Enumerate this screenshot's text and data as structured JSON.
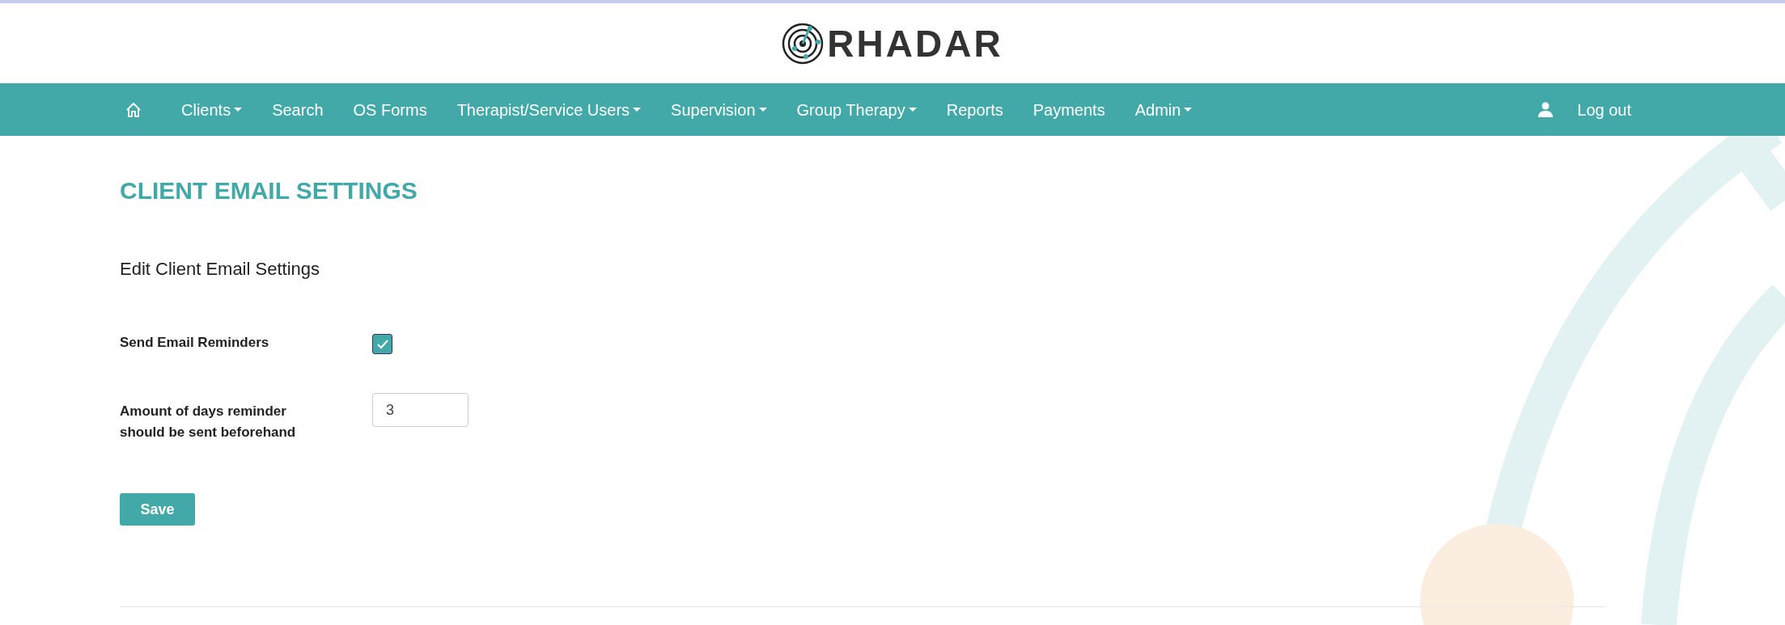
{
  "header": {
    "logo_text": "RHADAR"
  },
  "nav": {
    "items": [
      {
        "kind": "home"
      },
      {
        "kind": "link",
        "label": "Clients",
        "dropdown": true
      },
      {
        "kind": "link",
        "label": "Search",
        "dropdown": false
      },
      {
        "kind": "link",
        "label": "OS Forms",
        "dropdown": false
      },
      {
        "kind": "link",
        "label": "Therapist/Service Users",
        "dropdown": true
      },
      {
        "kind": "link",
        "label": "Supervision",
        "dropdown": true
      },
      {
        "kind": "link",
        "label": "Group Therapy",
        "dropdown": true
      },
      {
        "kind": "link",
        "label": "Reports",
        "dropdown": false
      },
      {
        "kind": "link",
        "label": "Payments",
        "dropdown": false
      },
      {
        "kind": "link",
        "label": "Admin",
        "dropdown": true
      }
    ],
    "right": {
      "label": "Log out"
    }
  },
  "page": {
    "title": "CLIENT EMAIL SETTINGS",
    "subtitle": "Edit Client Email Settings",
    "fields": [
      {
        "kind": "checkbox",
        "label": "Send Email Reminders",
        "checked": true
      },
      {
        "kind": "number",
        "label": "Amount of days reminder should be sent beforehand",
        "value": "3"
      }
    ],
    "save_button": "Save"
  }
}
